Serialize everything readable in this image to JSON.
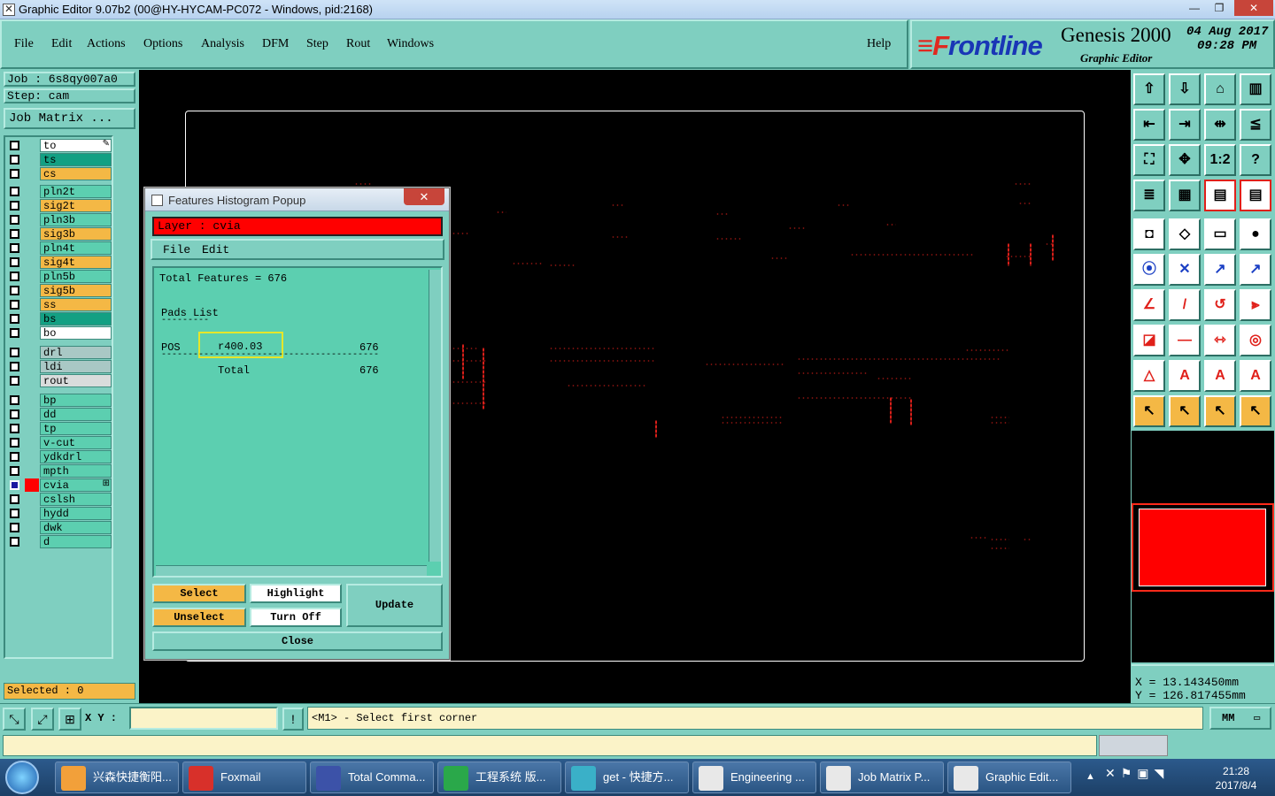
{
  "window": {
    "title": "Graphic Editor 9.07b2 (00@HY-HYCAM-PC072 - Windows, pid:2168)",
    "min": "—",
    "max": "❐",
    "close": "✕"
  },
  "menu": {
    "items": [
      "File",
      "Edit",
      "Actions",
      "Options",
      "Analysis",
      "DFM",
      "Step",
      "Rout",
      "Windows"
    ],
    "help": "Help"
  },
  "brand": {
    "logo_a": "≡F",
    "logo_b": "rontline",
    "product": "Genesis 2000",
    "subtitle": "Graphic Editor",
    "date": "04 Aug 2017",
    "time": "09:28 PM"
  },
  "job": {
    "job": "Job  :  6s8qy007a0",
    "step": "Step:  cam",
    "matrix": "Job Matrix ..."
  },
  "layers": [
    {
      "name": "to",
      "color": "#ffffff",
      "icon": "✎"
    },
    {
      "name": "ts",
      "color": "#13a083"
    },
    {
      "name": "cs",
      "color": "#f4b845"
    },
    {
      "name": "pln2t",
      "color": "#5ccfb0"
    },
    {
      "name": "sig2t",
      "color": "#f4b845"
    },
    {
      "name": "pln3b",
      "color": "#5ccfb0"
    },
    {
      "name": "sig3b",
      "color": "#f4b845"
    },
    {
      "name": "pln4t",
      "color": "#5ccfb0"
    },
    {
      "name": "sig4t",
      "color": "#f4b845"
    },
    {
      "name": "pln5b",
      "color": "#5ccfb0"
    },
    {
      "name": "sig5b",
      "color": "#f4b845"
    },
    {
      "name": "ss",
      "color": "#f4b845"
    },
    {
      "name": "bs",
      "color": "#13a083"
    },
    {
      "name": "bo",
      "color": "#ffffff"
    },
    {
      "name": "drl",
      "color": "#a9c8c5"
    },
    {
      "name": "ldi",
      "color": "#a9c8c5"
    },
    {
      "name": "rout",
      "color": "#d9dcdc"
    },
    {
      "name": "bp",
      "color": "#5ccfb0"
    },
    {
      "name": "dd",
      "color": "#5ccfb0"
    },
    {
      "name": "tp",
      "color": "#5ccfb0"
    },
    {
      "name": "v-cut",
      "color": "#5ccfb0"
    },
    {
      "name": "ydkdrl",
      "color": "#5ccfb0"
    },
    {
      "name": "mpth",
      "color": "#5ccfb0"
    },
    {
      "name": "cvia",
      "color": "#5ccfb0",
      "active": true,
      "icon": "⊞"
    },
    {
      "name": "cslsh",
      "color": "#5ccfb0"
    },
    {
      "name": "hydd",
      "color": "#5ccfb0"
    },
    {
      "name": "dwk",
      "color": "#5ccfb0"
    },
    {
      "name": "d",
      "color": "#5ccfb0"
    }
  ],
  "selected": "Selected : 0",
  "popup": {
    "title": "Features Histogram Popup",
    "close": "✕",
    "layer": "Layer :  cvia",
    "menu": [
      "File",
      "Edit"
    ],
    "total": "Total Features = 676",
    "pads_list": "Pads List",
    "pads_underline": "---------",
    "row_pos": "POS",
    "row_sym": "r400.03",
    "row_count": "676",
    "divider": "-----------------------------------------",
    "total_label": "Total",
    "total_count": "676",
    "buttons": {
      "select": "Select",
      "highlight": "Highlight",
      "unselect": "Unselect",
      "turnoff": "Turn Off",
      "update": "Update",
      "close": "Close"
    }
  },
  "coords": {
    "x": "X  =  13.143450mm",
    "y": "Y  =  126.817455mm"
  },
  "status": {
    "xy_label": "X Y :",
    "xy_value": "",
    "prompt": "<M1> - Select first corner",
    "units": "MM",
    "units_icon": "▭"
  },
  "taskbar": {
    "items": [
      {
        "label": "兴森快捷衡阳...",
        "color": "#f2a03a"
      },
      {
        "label": "Foxmail",
        "color": "#d8302a"
      },
      {
        "label": "Total Comma...",
        "color": "#3c52a8"
      },
      {
        "label": "工程系统  版...",
        "color": "#2aa84a"
      },
      {
        "label": "get - 快捷方...",
        "color": "#3ab0c8"
      },
      {
        "label": "Engineering ...",
        "color": "#e8e8e8"
      },
      {
        "label": "Job Matrix P...",
        "color": "#e8e8e8"
      },
      {
        "label": "Graphic Edit...",
        "color": "#e8e8e8"
      }
    ],
    "time": "21:28",
    "date": "2017/8/4"
  }
}
